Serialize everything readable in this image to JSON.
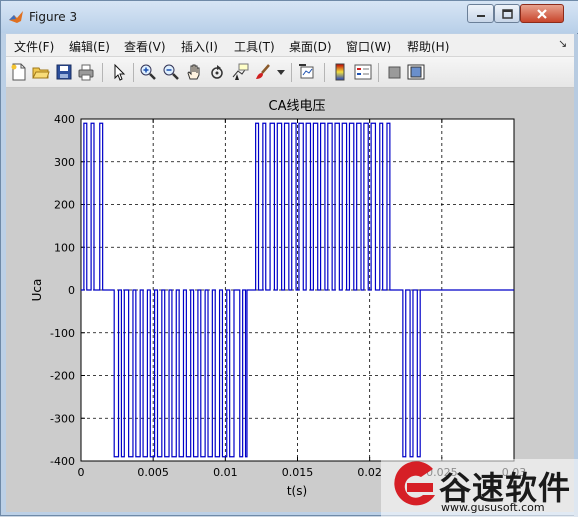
{
  "window": {
    "title": "Figure 3",
    "title_icon": "matlab-icon"
  },
  "menubar": {
    "items": [
      "文件(F)",
      "编辑(E)",
      "查看(V)",
      "插入(I)",
      "工具(T)",
      "桌面(D)",
      "窗口(W)",
      "帮助(H)"
    ]
  },
  "toolbar": {
    "icons": [
      "new-figure-icon",
      "open-icon",
      "save-icon",
      "print-icon",
      "pointer-icon",
      "zoom-in-icon",
      "zoom-out-icon",
      "pan-icon",
      "rotate-icon",
      "data-cursor-icon",
      "brush-icon",
      "link-icon",
      "colorbar-icon",
      "legend-icon",
      "hide-plot-tools-icon",
      "show-plot-tools-icon"
    ]
  },
  "chart_data": {
    "type": "line",
    "title": "CA线电压",
    "xlabel": "t(s)",
    "ylabel": "Uca",
    "xlim": [
      0,
      0.03
    ],
    "ylim": [
      -400,
      400
    ],
    "xticks": [
      "0",
      "0.005",
      "0.01",
      "0.015",
      "0.02",
      "0.025",
      "0.03"
    ],
    "yticks": [
      "-400",
      "-300",
      "-200",
      "-100",
      "0",
      "100",
      "200",
      "300",
      "400"
    ],
    "grid": true,
    "line_color": "#0000c8",
    "series": [
      {
        "pulses": [
          [
            0.0002,
            0.0004,
            390
          ],
          [
            0.0007,
            0.0009,
            390
          ],
          [
            0.0013,
            0.0015,
            390
          ],
          [
            0.0023,
            0.0026,
            -390
          ],
          [
            0.0028,
            0.003,
            -390
          ],
          [
            0.0033,
            0.0036,
            -390
          ],
          [
            0.0038,
            0.0041,
            -390
          ],
          [
            0.0043,
            0.0046,
            -390
          ],
          [
            0.0048,
            0.0051,
            -390
          ],
          [
            0.0053,
            0.0056,
            -390
          ],
          [
            0.0058,
            0.0061,
            -390
          ],
          [
            0.0063,
            0.0066,
            -390
          ],
          [
            0.0068,
            0.0071,
            -390
          ],
          [
            0.0073,
            0.0076,
            -390
          ],
          [
            0.0078,
            0.0081,
            -390
          ],
          [
            0.0083,
            0.0086,
            -390
          ],
          [
            0.0088,
            0.0091,
            -390
          ],
          [
            0.0093,
            0.0096,
            -390
          ],
          [
            0.0098,
            0.0101,
            -390
          ],
          [
            0.0103,
            0.0106,
            -390
          ],
          [
            0.011,
            0.0112,
            -390
          ],
          [
            0.0114,
            0.0115,
            -390
          ],
          [
            0.0121,
            0.0123,
            390
          ],
          [
            0.0126,
            0.0128,
            390
          ],
          [
            0.0131,
            0.0134,
            390
          ],
          [
            0.0136,
            0.0139,
            390
          ],
          [
            0.0141,
            0.0144,
            390
          ],
          [
            0.0146,
            0.0149,
            390
          ],
          [
            0.0151,
            0.0154,
            390
          ],
          [
            0.0156,
            0.0159,
            390
          ],
          [
            0.0161,
            0.0164,
            390
          ],
          [
            0.0166,
            0.0169,
            390
          ],
          [
            0.0171,
            0.0174,
            390
          ],
          [
            0.0176,
            0.0179,
            390
          ],
          [
            0.0181,
            0.0184,
            390
          ],
          [
            0.0186,
            0.0189,
            390
          ],
          [
            0.0191,
            0.0194,
            390
          ],
          [
            0.0196,
            0.0199,
            390
          ],
          [
            0.0201,
            0.0204,
            390
          ],
          [
            0.0207,
            0.0209,
            390
          ],
          [
            0.0212,
            0.0214,
            390
          ],
          [
            0.0223,
            0.0225,
            -390
          ],
          [
            0.0228,
            0.023,
            -390
          ],
          [
            0.0233,
            0.0235,
            -390
          ]
        ]
      }
    ]
  },
  "watermark": {
    "brand": "谷速软件",
    "url": "www.gususoft.com"
  }
}
